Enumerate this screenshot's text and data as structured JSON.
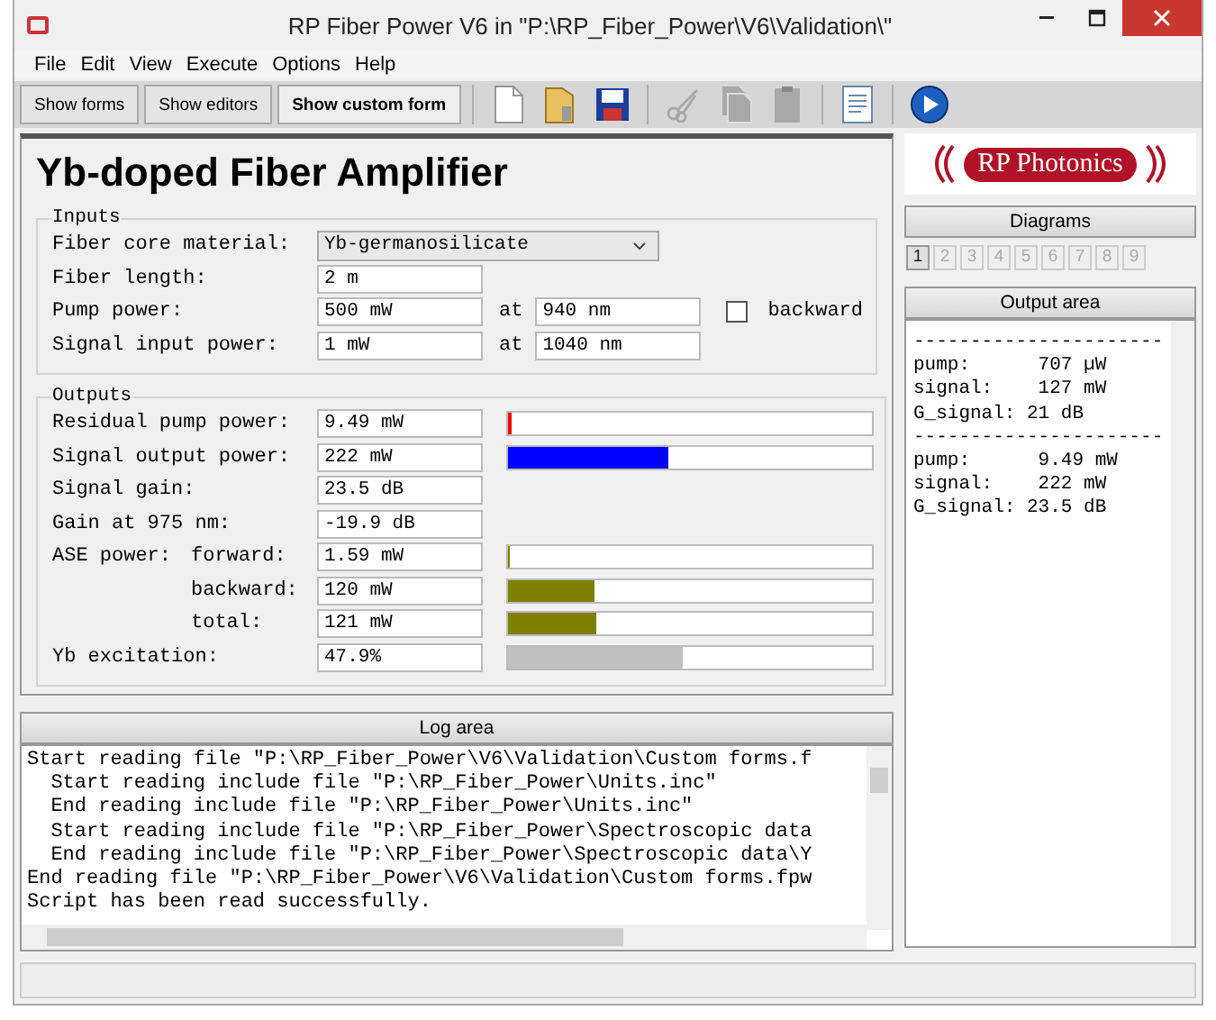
{
  "window": {
    "title": "RP Fiber Power V6 in \"P:\\RP_Fiber_Power\\V6\\Validation\\\""
  },
  "menu": [
    "File",
    "Edit",
    "View",
    "Execute",
    "Options",
    "Help"
  ],
  "toolbar_buttons": [
    {
      "label": "Show forms",
      "selected": false
    },
    {
      "label": "Show editors",
      "selected": false
    },
    {
      "label": "Show custom form",
      "selected": true
    }
  ],
  "toolbar_icons": [
    {
      "kind": "new",
      "disabled": false
    },
    {
      "kind": "open",
      "disabled": false
    },
    {
      "kind": "save",
      "disabled": false
    },
    {
      "kind": "cut",
      "disabled": true
    },
    {
      "kind": "copy",
      "disabled": true
    },
    {
      "kind": "paste",
      "disabled": true
    },
    {
      "kind": "text",
      "disabled": false
    },
    {
      "kind": "run",
      "disabled": false
    }
  ],
  "form": {
    "title": "Yb-doped Fiber Amplifier",
    "inputs_title": "Inputs",
    "inputs": [
      {
        "kind": "dropdown",
        "label": "Fiber core material:",
        "value": "Yb-germanosilicate"
      },
      {
        "kind": "field",
        "label": "Fiber length:",
        "value": "2 m"
      },
      {
        "kind": "field",
        "label": "Pump power:",
        "value": "500 mW",
        "at_label": "at",
        "at_value": "940 nm",
        "checkbox": {
          "label": "backward",
          "checked": false
        }
      },
      {
        "kind": "field",
        "label": "Signal input power:",
        "value": "1 mW",
        "at_label": "at",
        "at_value": "1040 nm"
      }
    ],
    "outputs_title": "Outputs",
    "outputs": [
      {
        "label": "Residual pump power:",
        "value": "9.49 mW",
        "level": 0.01,
        "color": "#ff0000"
      },
      {
        "label": "Signal output power:",
        "value": "222 mW",
        "level": 0.44,
        "color": "#0000ff"
      },
      {
        "label": "Signal gain:",
        "value": "23.5 dB"
      },
      {
        "label": "Gain at 975 nm:",
        "value": "-19.9 dB"
      },
      {
        "label": "ASE power:",
        "sublabel": "forward:",
        "value": "1.59 mW",
        "level": 0.004,
        "color": "#808000"
      },
      {
        "sublabel": "backward:",
        "value": "120 mW",
        "level": 0.24,
        "color": "#808000"
      },
      {
        "sublabel": "total:",
        "value": "121 mW",
        "level": 0.245,
        "color": "#808000"
      },
      {
        "label": "Yb excitation:",
        "value": "47.9%",
        "level": 0.479,
        "color": "#c0c0c0"
      }
    ]
  },
  "log": {
    "title": "Log area",
    "lines": [
      "Start reading file \"P:\\RP_Fiber_Power\\V6\\Validation\\Custom forms.f",
      "  Start reading include file \"P:\\RP_Fiber_Power\\Units.inc\"",
      "  End reading include file \"P:\\RP_Fiber_Power\\Units.inc\"",
      "  Start reading include file \"P:\\RP_Fiber_Power\\Spectroscopic data",
      "  End reading include file \"P:\\RP_Fiber_Power\\Spectroscopic data\\Y",
      "End reading file \"P:\\RP_Fiber_Power\\V6\\Validation\\Custom forms.fpw",
      "Script has been read successfully."
    ]
  },
  "logo": {
    "text": "RP Photonics"
  },
  "diagrams": {
    "title": "Diagrams",
    "tabs": [
      {
        "label": "1",
        "selected": true
      },
      {
        "label": "2",
        "selected": false
      },
      {
        "label": "3",
        "selected": false
      },
      {
        "label": "4",
        "selected": false
      },
      {
        "label": "5",
        "selected": false
      },
      {
        "label": "6",
        "selected": false
      },
      {
        "label": "7",
        "selected": false
      },
      {
        "label": "8",
        "selected": false
      },
      {
        "label": "9",
        "selected": false
      }
    ]
  },
  "output_area": {
    "title": "Output area",
    "lines": [
      "----------------------",
      "pump:      707 µW",
      "signal:    127 mW",
      "G_signal: 21 dB",
      "----------------------",
      "pump:      9.49 mW",
      "signal:    222 mW",
      "G_signal: 23.5 dB"
    ]
  }
}
